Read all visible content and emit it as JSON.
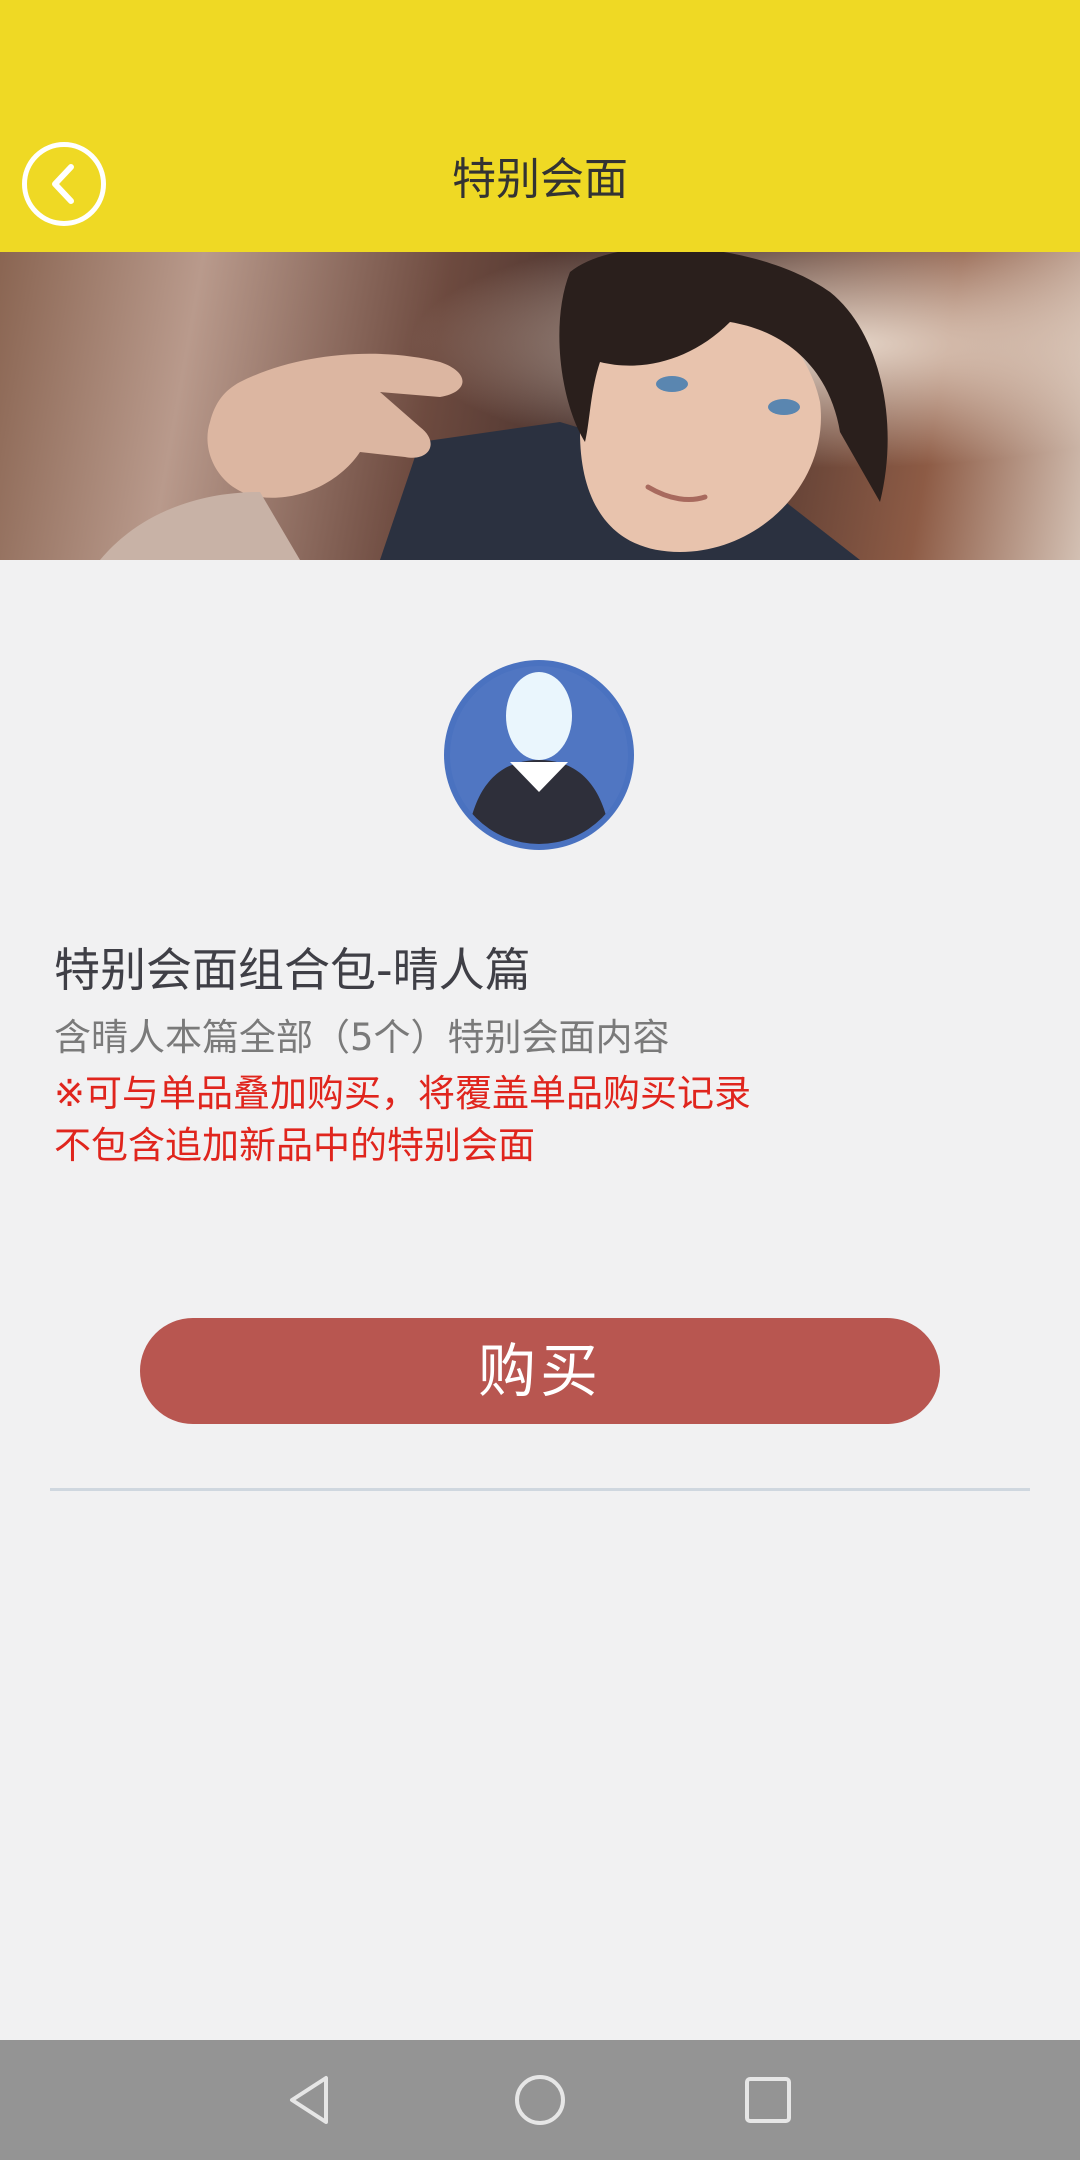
{
  "header": {
    "title": "特别会面"
  },
  "product": {
    "title": "特别会面组合包-晴人篇",
    "description": "含晴人本篇全部（5个）特别会面内容",
    "notice_line1": "※可与单品叠加购买，将覆盖单品购买记录",
    "notice_line2": "不包含追加新品中的特别会面"
  },
  "actions": {
    "buy_label": "购买"
  },
  "colors": {
    "header_bg": "#efd924",
    "buy_button": "#b85650",
    "notice_text": "#e0251d",
    "page_bg": "#f1f1f2",
    "avatar_bg": "#4a72c0"
  },
  "icons": {
    "back": "back-arrow-icon",
    "avatar": "avatar-icon",
    "nav_back": "nav-back-icon",
    "nav_home": "nav-home-icon",
    "nav_recent": "nav-recent-apps-icon"
  }
}
